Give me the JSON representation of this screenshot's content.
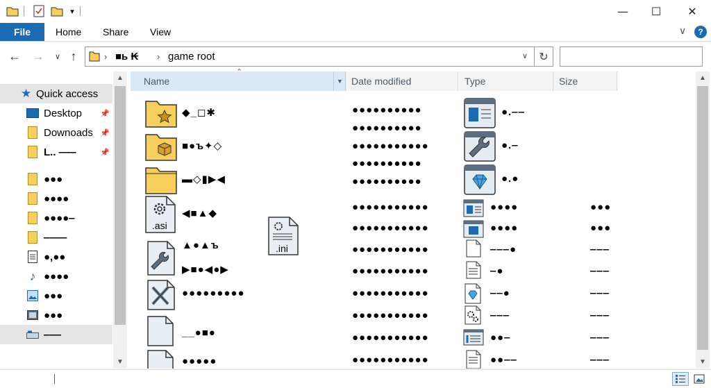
{
  "ribbon": {
    "file": "File",
    "home": "Home",
    "share": "Share",
    "view": "View"
  },
  "window": {
    "minimize": "—",
    "maximize": "☐",
    "close": "✕",
    "help": "?",
    "expand": "⌄"
  },
  "address": {
    "crumb_root": "■ь ₭",
    "crumb_sep1": "›",
    "crumb_sep2": "›",
    "path": "game root",
    "search_placeholder": ""
  },
  "nav": {
    "quick_access": "Quick access",
    "items": [
      {
        "label": "Desktop"
      },
      {
        "label": "Downoads"
      },
      {
        "label": "L.. ‒‒‒"
      },
      {
        "label": "●●●"
      },
      {
        "label": "●●●●"
      },
      {
        "label": "●●●●‒"
      },
      {
        "label": "‒‒‒‒"
      },
      {
        "label": "●,●●"
      },
      {
        "label": "●●●●"
      },
      {
        "label": "●●●"
      },
      {
        "label": "●●●"
      },
      {
        "label": "‒‒‒"
      }
    ]
  },
  "columns": {
    "name": "Name",
    "date": "Date modified",
    "type": "Type",
    "size": "Size"
  },
  "rows": [
    {
      "name": "◆_◻✱",
      "date1": "●●●●●●●●●●",
      "date2": "●●●●●●●●●●",
      "type": "●.‒‒",
      "size": ""
    },
    {
      "name": "■●ъ✦◇",
      "date1": "●●●●●●●●●●●",
      "date2": "●●●●●●●●●●",
      "type": "●.‒",
      "size": ""
    },
    {
      "name": "▬◇▮▶◀",
      "date1": "●●●●●●●●●●",
      "date2": "",
      "type": "●.●",
      "size": ""
    },
    {
      "name": "◀■▲◆",
      "date1": "●●●●●●●●●●●",
      "date2": "",
      "type": "●●●●",
      "size": "●●●"
    },
    {
      "name": "",
      "date1": "●●●●●●●●●●●",
      "date2": "",
      "type": "●●●●",
      "size": "●●●"
    },
    {
      "name": "▲●▲ъ",
      "date1": "●●●●●●●●●●●",
      "date2": "",
      "type": "‒‒‒●",
      "size": "‒‒‒"
    },
    {
      "name": "▶■●◀●▶",
      "date1": "●●●●●●●●●●●",
      "date2": "",
      "type": "‒●",
      "size": "‒‒‒"
    },
    {
      "name": "●●●●●●●●●",
      "date1": "●●●●●●●●●●●",
      "date2": "",
      "type": "‒‒●",
      "size": "‒‒‒"
    },
    {
      "name": "",
      "date1": "●●●●●●●●●●●",
      "date2": "",
      "type": "‒‒‒",
      "size": "‒‒‒"
    },
    {
      "name": "__●■●",
      "date1": "●●●●●●●●●●●",
      "date2": "",
      "type": "●●‒",
      "size": "‒‒‒"
    },
    {
      "name": "●●●●●",
      "date1": "●●●●●●●●●●●",
      "date2": "",
      "type": "●●‒‒",
      "size": "‒‒‒"
    }
  ],
  "file_labels": {
    "asi": ".asi",
    "ini": ".ini"
  }
}
